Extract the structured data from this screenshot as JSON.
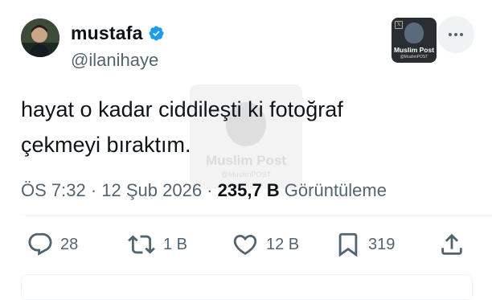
{
  "author": {
    "display_name": "mustafa",
    "handle": "@ilanihaye",
    "verified": true,
    "verified_color": "#1d9bf0"
  },
  "profile_badge": {
    "brand": "Muslim Post",
    "sub": "@MuslimPOST"
  },
  "more_icon": "more-horizontal-icon",
  "tweet": {
    "text": "hayat o kadar ciddileşti ki fotoğraf\nçekmeyi bıraktım."
  },
  "watermark": {
    "brand": "Muslim Post",
    "sub": "@MuslimPOST"
  },
  "meta": {
    "time": "ÖS 7:32",
    "separator": " · ",
    "date": "12 Şub 2026",
    "views": "235,7 B",
    "views_label": " Görüntüleme"
  },
  "actions": {
    "reply": {
      "icon": "reply-icon",
      "count": "28"
    },
    "repost": {
      "icon": "repost-icon",
      "count": "1 B"
    },
    "like": {
      "icon": "heart-icon",
      "count": "12 B"
    },
    "bookmark": {
      "icon": "bookmark-icon",
      "count": "319"
    },
    "share": {
      "icon": "share-icon"
    }
  },
  "colors": {
    "text": "#0f1419",
    "secondary": "#536471",
    "accent": "#1d9bf0"
  }
}
